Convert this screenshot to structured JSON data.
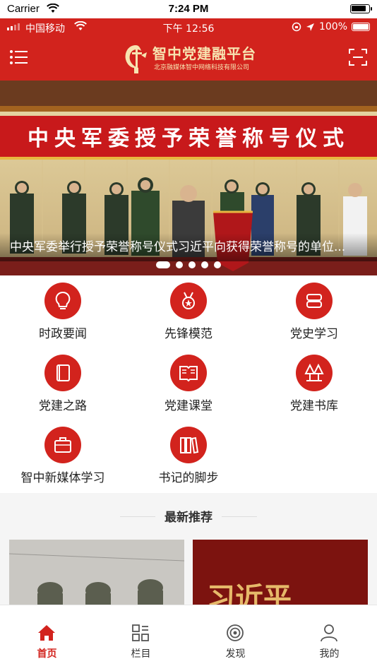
{
  "sim_status": {
    "carrier": "Carrier",
    "time": "7:24 PM"
  },
  "app_status": {
    "carrier": "中国移动",
    "time": "下午 12:56",
    "battery": "100%"
  },
  "header": {
    "title": "智中党建融平台",
    "subtitle": "北京融媒体智中网络科技有限公司",
    "brand_color": "#d2231d"
  },
  "banner": {
    "sign_text": "中央军委授予荣誉称号仪式",
    "caption": "中央军委举行授予荣誉称号仪式习近平向获得荣誉称号的单位...",
    "dot_count": 5,
    "active_dot": 1
  },
  "grid": {
    "items": [
      {
        "label": "时政要闻",
        "icon": "lightbulb-icon"
      },
      {
        "label": "先锋模范",
        "icon": "medal-icon"
      },
      {
        "label": "党史学习",
        "icon": "scroll-icon"
      },
      {
        "label": "党建之路",
        "icon": "book-icon"
      },
      {
        "label": "党建课堂",
        "icon": "open-book-icon"
      },
      {
        "label": "党建书库",
        "icon": "trees-icon"
      },
      {
        "label": "智中新媒体学习",
        "icon": "briefcase-icon"
      },
      {
        "label": "书记的脚步",
        "icon": "books-icon"
      }
    ]
  },
  "recommend": {
    "title": "最新推荐",
    "cards": [
      {
        "icon": "soldiers-photo"
      },
      {
        "text": "习近平",
        "icon": "calligraphy-photo"
      }
    ]
  },
  "tabbar": {
    "items": [
      {
        "label": "首页",
        "icon": "home-icon",
        "active": true
      },
      {
        "label": "栏目",
        "icon": "grid-icon",
        "active": false
      },
      {
        "label": "发现",
        "icon": "target-icon",
        "active": false
      },
      {
        "label": "我的",
        "icon": "user-icon",
        "active": false
      }
    ]
  }
}
